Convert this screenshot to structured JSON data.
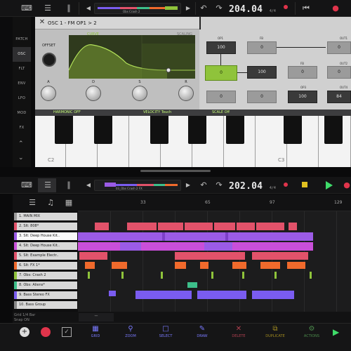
{
  "top": {
    "track_name": "Obs Crash 2",
    "bpm": "204.04",
    "bpm_sub": "4/4",
    "osc_title": "OSC 1 - FM OP1 > 2",
    "curve_label": "CURVE",
    "scaling_label": "SCALING",
    "offset_label": "OFFSET",
    "knobs": [
      "A",
      "D",
      "S",
      "R"
    ],
    "sidebar": [
      "PATCH",
      "OSC",
      "FLT",
      "ENV",
      "LFO",
      "MOD",
      "FX"
    ],
    "fm_ops": {
      "op1_label": "OP1",
      "op1_value": "100",
      "fb_top_label": "FB",
      "fb_top_value": "0",
      "out1_label": "OUT1",
      "out1_value": "0",
      "op2_value": "0",
      "mid_value": "100",
      "fb_mid_label": "FB",
      "fb_mid_value": "0",
      "out2_label": "OUT2",
      "out2_value": "0",
      "out3_value": "0",
      "bot2_value": "0",
      "op3_label": "OP3",
      "op3_value": "100",
      "out4_label": "OUT4",
      "out4_value": "84"
    },
    "keyboard_bar": {
      "harmonic": "HARMONIC OFF",
      "velocity": "VELOCITY Touch",
      "scale": "SCALE Off"
    },
    "key_labels": [
      "C2",
      "C3"
    ]
  },
  "bottom": {
    "track_name": "03_Obs Crash 2 FX",
    "bpm": "202.04",
    "bpm_sub": "4/4",
    "ruler": [
      "33",
      "65",
      "97",
      "129"
    ],
    "tracks": [
      {
        "name": "1. MAIN MIX",
        "color": "#9a9a9a"
      },
      {
        "name": "2. Slt: 808*",
        "color": "#e2526a"
      },
      {
        "name": "3. Slt: Deep House Kit..",
        "color": "#9b5be6"
      },
      {
        "name": "4. Slt: Deep House Kit..",
        "color": "#c94fd9"
      },
      {
        "name": "5. Slt: Example Electr..",
        "color": "#e2526a"
      },
      {
        "name": "6. Slt: FX 1*",
        "color": "#f06a2c"
      },
      {
        "name": "7. Obs: Crash 2",
        "color": "#8fc33b"
      },
      {
        "name": "8. Obs: Aliens*",
        "color": "#3dbf8a"
      },
      {
        "name": "9. Bass Stereo FX",
        "color": "#7a5cf0"
      },
      {
        "name": "10. Bass Group",
        "color": "#888888"
      }
    ],
    "info": [
      "Grid 1/4 Bar",
      "Snap ON"
    ],
    "tools": [
      "GRID",
      "ZOOM",
      "SELECT",
      "DRAW",
      "DELETE",
      "DUPLICATE",
      "ACTIONS"
    ]
  },
  "colors": {
    "accent_green": "#8fc33b",
    "accent_purple": "#7a5cf0",
    "record_red": "#e0344b"
  }
}
